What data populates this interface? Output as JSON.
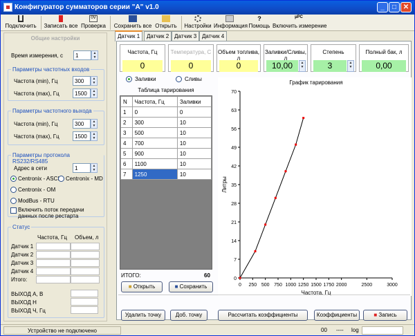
{
  "window": {
    "title": "Конфигуратор сумматоров серии  \"А\" v1.0"
  },
  "toolbar": {
    "connect": "Подключить",
    "write_all": "Записать все",
    "check": "Проверка",
    "save_all": "Сохранить все",
    "open": "Открыть",
    "settings": "Настройки",
    "info": "Информация",
    "help": "Помощь",
    "enable_meas": "Включить измерение"
  },
  "left": {
    "header": "Общие настройки",
    "meas_time_label": "Время измерения, с",
    "meas_time": "1",
    "freq_in": {
      "title": "Параметры частотных входов",
      "min_label": "Частота (min), Гц",
      "min": "300",
      "max_label": "Частота (max), Гц",
      "max": "1500"
    },
    "freq_out": {
      "title": "Параметры частотного выхода",
      "min_label": "Частота (min), Гц",
      "min": "300",
      "max_label": "Частота (max), Гц",
      "max": "1500"
    },
    "proto": {
      "title": "Параметры протокола RS232/RS485",
      "addr_label": "Адрес в сети",
      "addr": "1",
      "r1": "Centronix - ASCII",
      "r2": "Centronix - MD",
      "r3": "Centronix - OM",
      "r4": "ModBus - RTU",
      "chk": "Включить поток передачи данных после рестарта"
    },
    "status": {
      "title": "Статус",
      "col_freq": "Частота, Гц",
      "col_vol": "Объем, л",
      "rows": [
        "Датчик 1",
        "Датчик 2",
        "Датчик 3",
        "Датчик 4",
        "Итого:"
      ],
      "out_a": "ВЫХОД А, В",
      "out_n": "ВЫХОД Н",
      "out_ch": "ВЫХОД Ч, Гц"
    }
  },
  "tabs": [
    "Датчик 1",
    "Датчик 2",
    "Датчик 3",
    "Датчик 4"
  ],
  "boxes": [
    {
      "label": "Частота, Гц",
      "value": "0",
      "color": "#ffff99"
    },
    {
      "label": "Температура, С",
      "value": "0",
      "color": "#ffff99"
    },
    {
      "label": "Объем топлива, л",
      "value": "0",
      "color": "#ffff99"
    },
    {
      "label": "Заливки/Сливы, л",
      "value": "10,00",
      "color": "#a6f0a6"
    },
    {
      "label": "Степень",
      "value": "3",
      "color": "#a6f0a6"
    },
    {
      "label": "Полный бак, л",
      "value": "0,00",
      "color": "#a6f0a6"
    }
  ],
  "mode": {
    "fill": "Заливки",
    "drain": "Сливы"
  },
  "table": {
    "title": "Таблица тарирования",
    "cols": [
      "N",
      "Частота, Гц",
      "Заливки"
    ],
    "rows": [
      [
        "1",
        "0",
        "0"
      ],
      [
        "2",
        "300",
        "10"
      ],
      [
        "3",
        "500",
        "10"
      ],
      [
        "4",
        "700",
        "10"
      ],
      [
        "5",
        "900",
        "10"
      ],
      [
        "6",
        "1100",
        "10"
      ],
      [
        "7",
        "1250",
        "10"
      ]
    ],
    "total_label": "ИТОГО:",
    "total": "60",
    "open": "Открыть",
    "save": "Сохранить"
  },
  "chart_data": {
    "type": "line",
    "title": "График тарирования",
    "xlabel": "Частота, Гц",
    "ylabel": "Литры",
    "xlim": [
      0,
      3000
    ],
    "ylim": [
      0,
      70
    ],
    "xticks": [
      0,
      250,
      500,
      750,
      1000,
      1250,
      1500,
      1750,
      2000,
      2500,
      3000
    ],
    "yticks": [
      0,
      7,
      14,
      21,
      28,
      35,
      42,
      49,
      56,
      63,
      70
    ],
    "series": [
      {
        "x": [
          0,
          300,
          500,
          700,
          900,
          1100,
          1250
        ],
        "y": [
          0,
          10,
          20,
          30,
          40,
          50,
          60
        ]
      }
    ]
  },
  "bottom": {
    "del": "Удалить точку",
    "add": "Доб. точку",
    "calc": "Рассчитать коэффициенты",
    "coef": "Коэффициенты",
    "write": "Запись"
  },
  "status": {
    "conn": "Устройство не подключено",
    "v1": "00",
    "v2": "----",
    "log": "log"
  }
}
